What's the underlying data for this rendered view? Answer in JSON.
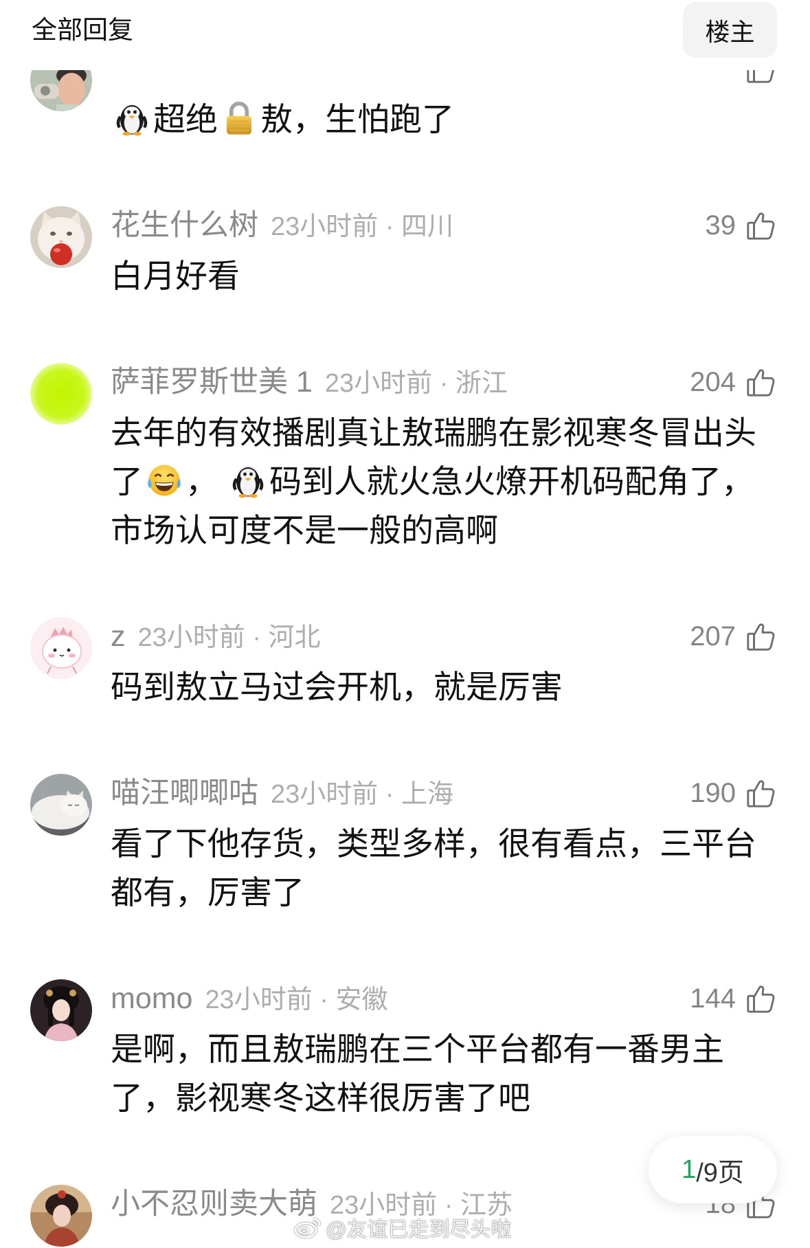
{
  "header": {
    "title": "全部回复",
    "op_filter_label": "楼主"
  },
  "like_icon": "thumbs-up-icon",
  "comments": [
    {
      "avatar": "person-photo-avatar",
      "lines": [
        [
          {
            "emoji": "penguin-emoji-icon"
          },
          {
            "text": "超绝"
          },
          {
            "emoji": "lock-emoji-icon"
          },
          {
            "text": "敖，生怕跑了"
          }
        ]
      ]
    },
    {
      "avatar": "cat-apple-avatar",
      "name": "花生什么树",
      "meta": "23小时前 · 四川",
      "likes": "39",
      "lines": [
        [
          {
            "text": "白月好看"
          }
        ]
      ]
    },
    {
      "avatar": "lime-circle-avatar",
      "name": "萨菲罗斯世美 1",
      "meta": "23小时前 · 浙江",
      "likes": "204",
      "lines": [
        [
          {
            "text": "去年的有效播剧真让敖瑞鹏在影视寒冬冒出头"
          }
        ],
        [
          {
            "text": "了"
          },
          {
            "emoji": "tears-of-joy-emoji-icon"
          },
          {
            "text": "， "
          },
          {
            "emoji": "penguin-emoji-icon"
          },
          {
            "text": "码到人就火急火燎开机码配角了，"
          }
        ],
        [
          {
            "text": "市场认可度不是一般的高啊"
          }
        ]
      ]
    },
    {
      "avatar": "pink-cartoon-avatar",
      "name": "z",
      "meta": "23小时前 · 河北",
      "likes": "207",
      "lines": [
        [
          {
            "text": "码到敖立马过会开机，就是厉害"
          }
        ]
      ]
    },
    {
      "avatar": "white-cat-avatar",
      "name": "喵汪唧唧咕",
      "meta": "23小时前 · 上海",
      "likes": "190",
      "lines": [
        [
          {
            "text": "看了下他存货，类型多样，很有看点，三平台"
          }
        ],
        [
          {
            "text": "都有，厉害了"
          }
        ]
      ]
    },
    {
      "avatar": "costume-woman-avatar",
      "name": "momo",
      "meta": "23小时前 · 安徽",
      "likes": "144",
      "lines": [
        [
          {
            "text": "是啊，而且敖瑞鹏在三个平台都有一番男主"
          }
        ],
        [
          {
            "text": "了，影视寒冬这样很厉害了吧"
          }
        ]
      ]
    },
    {
      "avatar": "costume-woman-red-avatar",
      "name": "小不忍则卖大萌",
      "meta": "23小时前 · 江苏",
      "likes": "18",
      "lines": []
    }
  ],
  "pagination": {
    "current": "1",
    "suffix": "/9页"
  },
  "watermark": {
    "logo": "weibo-logo-icon",
    "text": "@友谊已走到尽头啦"
  },
  "colors": {
    "accent_green": "#1fa65a",
    "username": "#8a8a8a",
    "meta": "#adadad",
    "text": "#111111",
    "op_button_bg": "#f3f3f3"
  }
}
